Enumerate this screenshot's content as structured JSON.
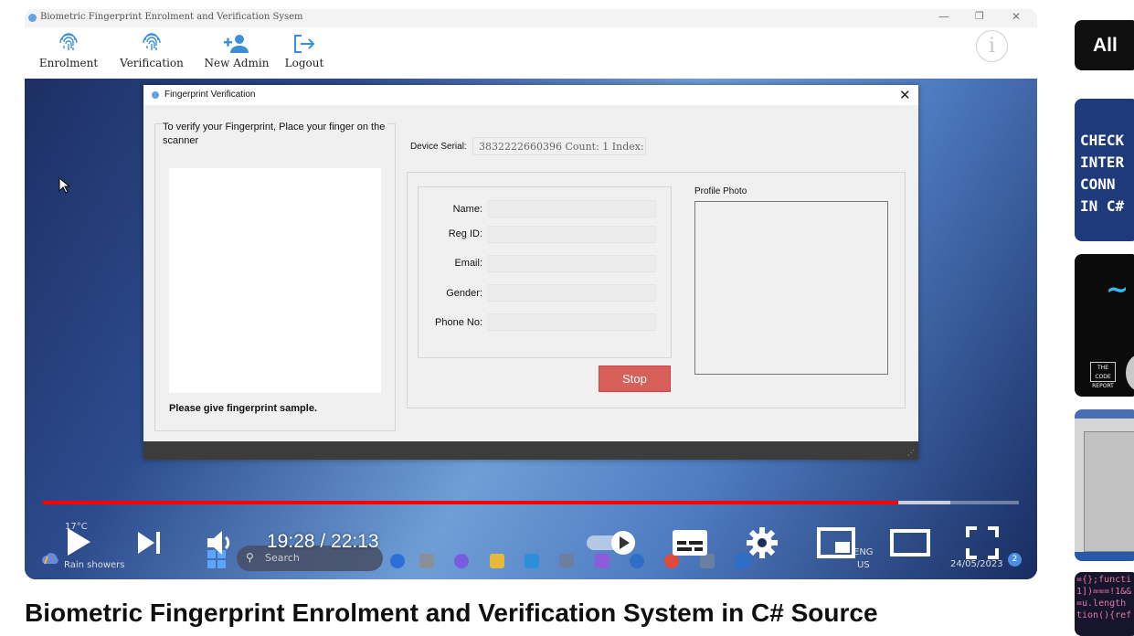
{
  "app": {
    "window_title": "Biometric Fingerprint Enrolment and Verification Sysem",
    "toolbar": [
      {
        "label": "Enrolment",
        "icon": "fingerprint-icon"
      },
      {
        "label": "Verification",
        "icon": "fingerprint-icon"
      },
      {
        "label": "New Admin",
        "icon": "add-user-icon"
      },
      {
        "label": "Logout",
        "icon": "logout-icon"
      }
    ]
  },
  "dialog": {
    "title": "Fingerprint Verification",
    "instruction": "To verify your Fingerprint, Place your finger on the scanner",
    "prompt": "Please give fingerprint sample.",
    "device_serial_label": "Device Serial:",
    "device_serial_value": "3832222660396 Count: 1 Index: (",
    "fields": [
      {
        "label": "Name:",
        "value": ""
      },
      {
        "label": "Reg ID:",
        "value": ""
      },
      {
        "label": "Email:",
        "value": ""
      },
      {
        "label": "Gender:",
        "value": ""
      },
      {
        "label": "Phone No:",
        "value": ""
      }
    ],
    "profile_photo_label": "Profile Photo",
    "stop_label": "Stop"
  },
  "taskbar": {
    "temperature": "17°C",
    "weather": "Rain showers",
    "search_placeholder": "Search",
    "lang_line1": "ENG",
    "lang_line2": "US",
    "date": "24/05/2023",
    "notification_count": "2"
  },
  "player": {
    "current_time": "19:28",
    "duration": "22:13",
    "time_display": "19:28 / 22:13",
    "progress": 0.876,
    "buffered": 0.93,
    "accent_color": "#ff0000"
  },
  "video_title": "Biometric Fingerprint Enrolment and Verification System in C# Source",
  "sidebar": {
    "chip_label": "All",
    "thumb1_text": "CHECK\nINTER\nCONN\nIN C#",
    "thumb2_badge": "THE CODE REPORT",
    "thumb4_code": "={};functi\n1])===!1&&\n=u.length\ntion(){ref"
  },
  "colors": {
    "stop_button": "#d9605a",
    "dialog_background": "#f0f0f0",
    "notification_badge": "#4a8ee0"
  }
}
